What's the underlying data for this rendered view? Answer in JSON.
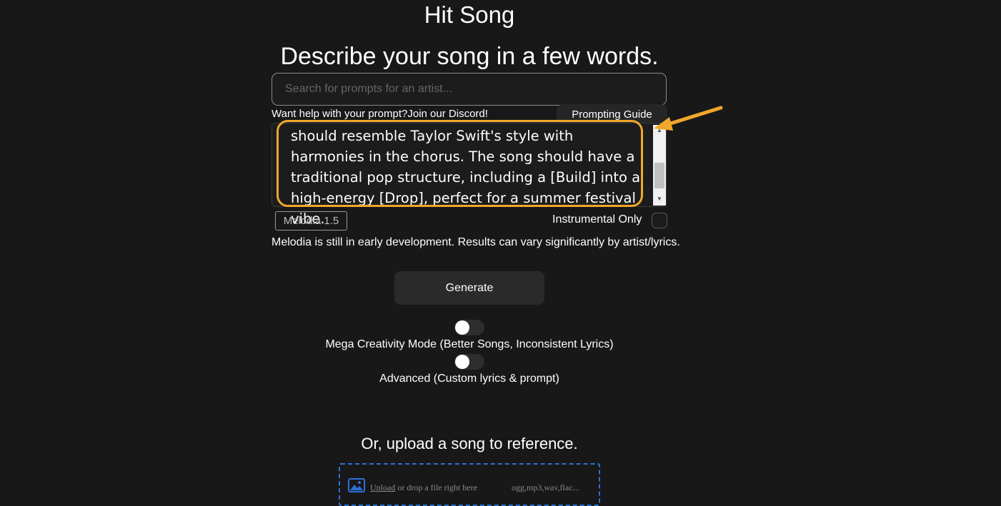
{
  "header": {
    "app_title": "Hit Song",
    "heading": "Describe your song in a few words."
  },
  "search": {
    "placeholder": "Search for prompts for an artist...",
    "value": ""
  },
  "help": {
    "question": "Want help with your prompt?",
    "link_label": "Join our Discord!"
  },
  "prompting_guide_label": "Prompting Guide",
  "prompt": {
    "visible_text": "should resemble Taylor Swift's style with harmonies in the chorus. The song should have a traditional pop structure, including a [Build] into a high-energy [Drop], perfect for a summer festival vibe.",
    "scroll_fraction": 0.7
  },
  "model": {
    "label": "Melodia 1.5"
  },
  "instrumental": {
    "label": "Instrumental Only",
    "checked": false
  },
  "disclaimer": "Melodia is still in early development. Results can vary significantly by artist/lyrics.",
  "generate_label": "Generate",
  "toggles": {
    "mega": {
      "label": "Mega Creativity Mode (Better Songs, Inconsistent Lyrics)",
      "on": false
    },
    "advanced": {
      "label": "Advanced (Custom lyrics & prompt)",
      "on": false
    }
  },
  "upload": {
    "heading": "Or, upload a song to reference.",
    "link_label": "Upload",
    "drop_text": "or drop a file right here",
    "formats": "ogg,mp3,wav,flac..."
  },
  "colors": {
    "background": "#181818",
    "highlight": "#f0a72a",
    "dropzone_border": "#2f6fd6"
  },
  "icons": {
    "annotation": "arrow-icon",
    "upload": "image-upload-icon"
  }
}
